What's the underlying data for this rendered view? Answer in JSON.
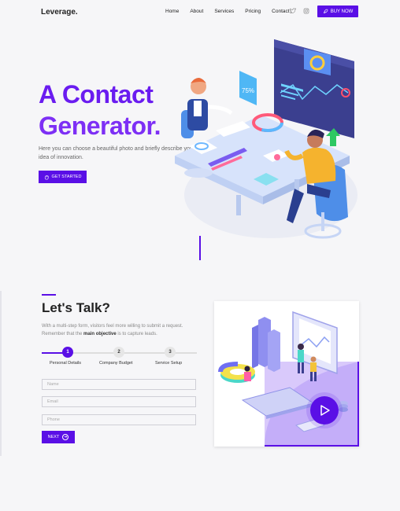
{
  "nav": {
    "logo": "Leverage.",
    "links": [
      "Home",
      "About",
      "Services",
      "Pricing",
      "Contact"
    ],
    "social_icons": [
      "twitter-icon",
      "instagram-icon"
    ],
    "buy_label": "BUY NOW"
  },
  "hero": {
    "title_line1": "A Contact",
    "title_line2": "Generator.",
    "description": "Here you can choose a beautiful photo and briefly describe your idea of innovation.",
    "cta_label": "GET STARTED",
    "badge_value": "75%"
  },
  "contact": {
    "title": "Let's Talk?",
    "desc_part1": "With a multi-step form, visitors feel more willing to submit a request. Remember that the ",
    "desc_bold": "main objective",
    "desc_part2": " is to capture leads.",
    "steps": [
      {
        "number": "1",
        "label": "Personal Details"
      },
      {
        "number": "2",
        "label": "Company Budget"
      },
      {
        "number": "3",
        "label": "Service Setup"
      }
    ],
    "active_step": 1,
    "fields": [
      {
        "placeholder": "Name"
      },
      {
        "placeholder": "Email"
      },
      {
        "placeholder": "Phone"
      }
    ],
    "next_label": "NEXT"
  },
  "colors": {
    "accent": "#5a0fe6",
    "title_gradient": [
      "#5a0fe6",
      "#8a3cf7"
    ],
    "background": "#f6f6f8"
  }
}
